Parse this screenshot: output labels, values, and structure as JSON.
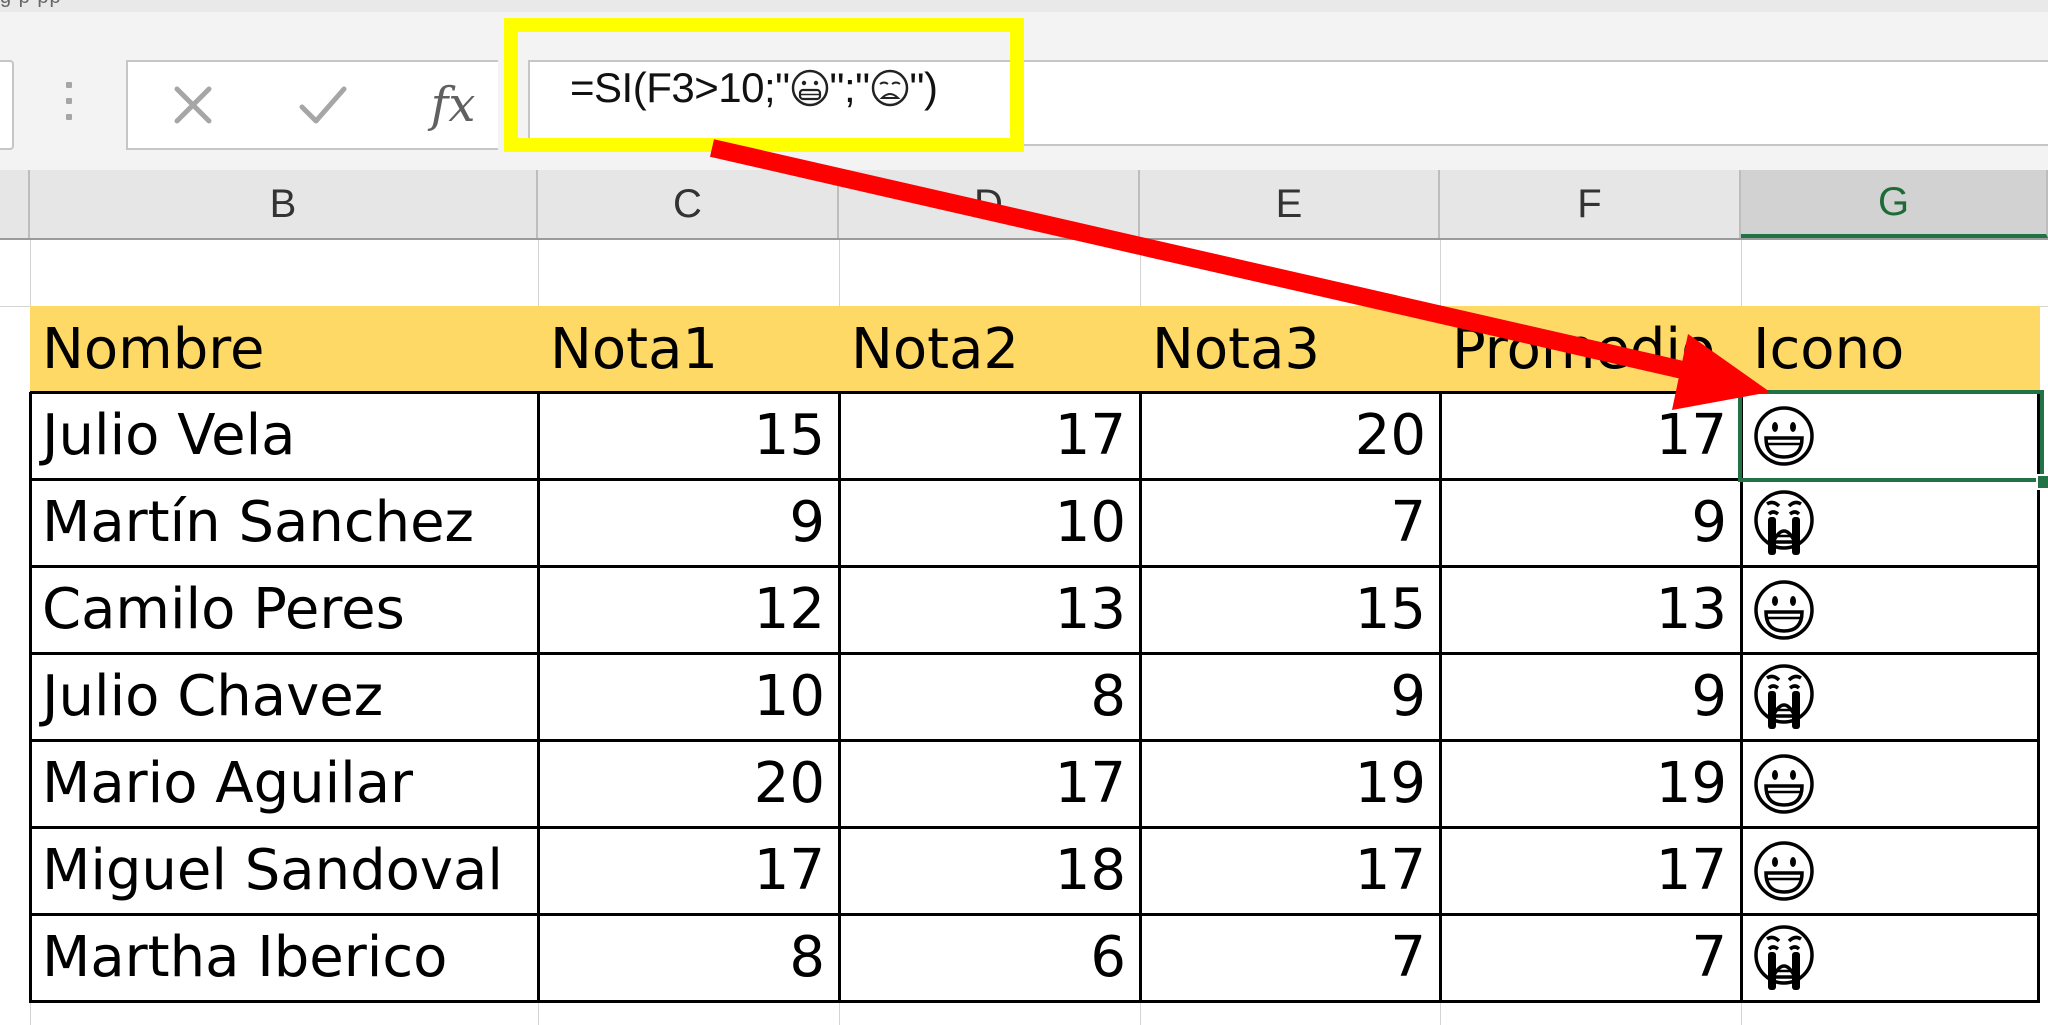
{
  "ribbon": {
    "partial_text": "g   p        pp"
  },
  "formula_bar": {
    "cancel_icon": "close-icon",
    "enter_icon": "check-icon",
    "fx_label": "fx",
    "formula_prefix": "=SI(F3>10;\"",
    "formula_mid": "\";\"",
    "formula_suffix": "\")"
  },
  "columns": [
    "B",
    "C",
    "D",
    "E",
    "F",
    "G"
  ],
  "active_column": "G",
  "table": {
    "headers": [
      "Nombre",
      "Nota1",
      "Nota2",
      "Nota3",
      "Promedio",
      "Icono"
    ],
    "rows": [
      {
        "nombre": "Julio Vela",
        "nota1": "15",
        "nota2": "17",
        "nota3": "20",
        "promedio": "17",
        "icono": "happy"
      },
      {
        "nombre": "Martín Sanchez",
        "nota1": "9",
        "nota2": "10",
        "nota3": "7",
        "promedio": "9",
        "icono": "crying"
      },
      {
        "nombre": "Camilo Peres",
        "nota1": "12",
        "nota2": "13",
        "nota3": "15",
        "promedio": "13",
        "icono": "happy"
      },
      {
        "nombre": "Julio Chavez",
        "nota1": "10",
        "nota2": "8",
        "nota3": "9",
        "promedio": "9",
        "icono": "crying"
      },
      {
        "nombre": "Mario Aguilar",
        "nota1": "20",
        "nota2": "17",
        "nota3": "19",
        "promedio": "19",
        "icono": "happy"
      },
      {
        "nombre": "Miguel Sandoval",
        "nota1": "17",
        "nota2": "18",
        "nota3": "17",
        "promedio": "17",
        "icono": "happy"
      },
      {
        "nombre": "Martha Iberico",
        "nota1": "8",
        "nota2": "6",
        "nota3": "7",
        "promedio": "7",
        "icono": "crying"
      }
    ]
  },
  "colors": {
    "header_fill": "#ffd966",
    "highlight": "#ffff00",
    "arrow": "#ff0000",
    "active_cell": "#217346"
  }
}
